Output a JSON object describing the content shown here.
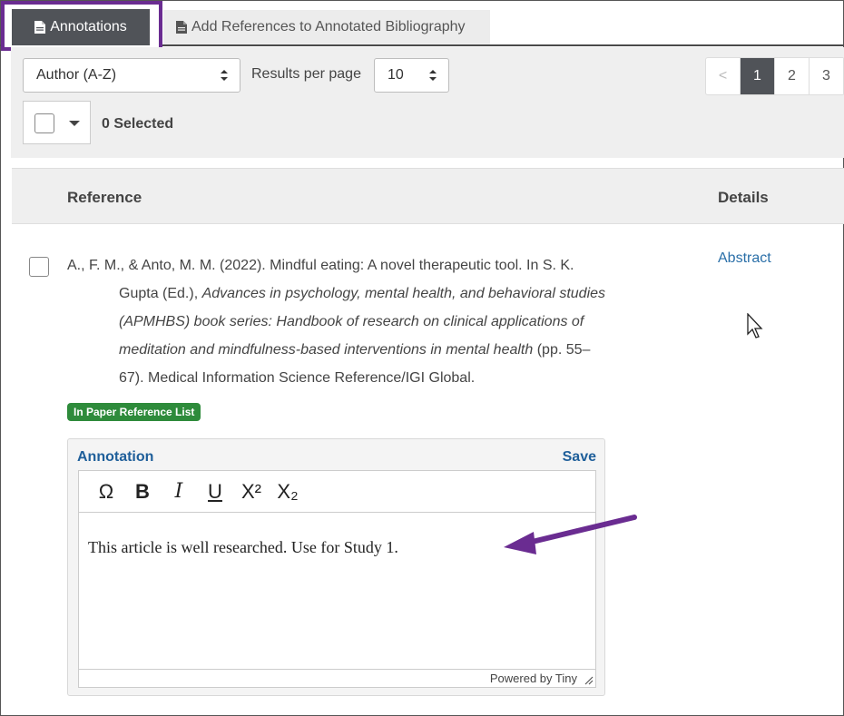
{
  "tabs": {
    "active": {
      "label": "Annotations",
      "icon": "document-icon"
    },
    "inactive": {
      "label": "Add References to Annotated Bibliography",
      "icon": "document-icon"
    }
  },
  "toolbar": {
    "sort_value": "Author (A-Z)",
    "results_label": "Results per page",
    "per_page_value": "10",
    "selected_text": "0 Selected",
    "pagination": {
      "prev": "<",
      "pages": [
        "1",
        "2",
        "3"
      ],
      "current": "1"
    }
  },
  "table": {
    "headers": {
      "reference": "Reference",
      "details": "Details"
    },
    "row": {
      "citation": {
        "line1": "A., F. M., & Anto, M. M. (2022). Mindful eating: A novel therapeutic tool. In S. K.",
        "line2_plain": "Gupta (Ed.), ",
        "line2_italic": "Advances in psychology, mental health, and behavioral studies",
        "line3_italic": "(APMHBS) book series: Handbook of research on clinical applications of",
        "line4_italic": "meditation and mindfulness-based interventions in mental health",
        "line4_plain": " (pp. 55–",
        "line5": "67). Medical Information Science Reference/IGI Global."
      },
      "details_link": "Abstract",
      "badge": "In Paper Reference List",
      "annotation": {
        "label": "Annotation",
        "save_label": "Save",
        "content": "This article is well researched. Use for Study 1.",
        "powered_by": "Powered by Tiny",
        "tools": [
          {
            "name": "special-character-icon",
            "glyph": "Ω"
          },
          {
            "name": "bold-icon",
            "glyph": "B"
          },
          {
            "name": "italic-icon",
            "glyph": "I"
          },
          {
            "name": "underline-icon",
            "glyph": "U"
          },
          {
            "name": "superscript-icon",
            "glyph": "X²"
          },
          {
            "name": "subscript-icon",
            "glyph": "X₂"
          }
        ]
      }
    }
  },
  "colors": {
    "highlight_outline": "#6a2c91",
    "arrow": "#6a2c91",
    "badge": "#2e8b3b",
    "link": "#2a6fa8",
    "tab_active_bg": "#505358"
  }
}
